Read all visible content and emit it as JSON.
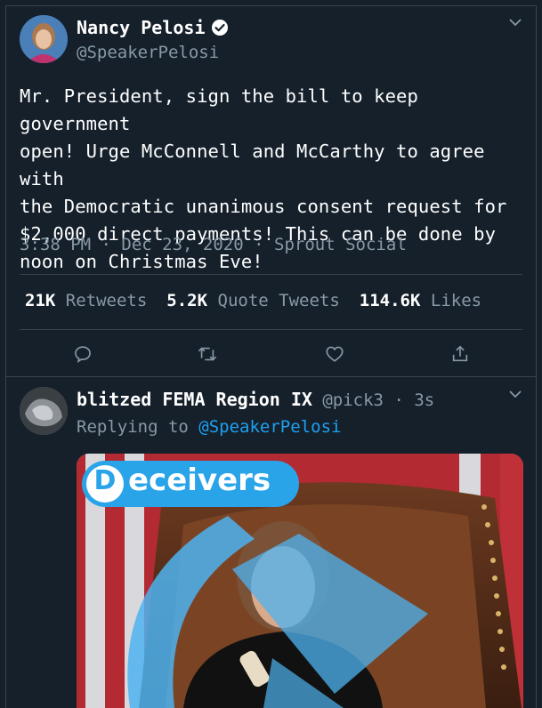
{
  "main_tweet": {
    "author_name": "Nancy Pelosi",
    "verified": true,
    "handle": "@SpeakerPelosi",
    "text": "Mr. President, sign the bill to keep government\nopen! Urge McConnell and McCarthy to agree with\nthe Democratic unanimous consent request for\n$2,000 direct payments! This can be done by\nnoon on Christmas Eve!",
    "time": "3:38 PM",
    "date": "Dec 23, 2020",
    "source": "Sprout Social",
    "retweets_count": "21K",
    "retweets_label": "Retweets",
    "quote_count": "5.2K",
    "quote_label": "Quote Tweets",
    "likes_count": "114.6K",
    "likes_label": "Likes",
    "actions": [
      "reply-icon",
      "retweet-icon",
      "like-icon",
      "share-icon"
    ]
  },
  "reply": {
    "author_name": "blitzed FEMA Region IX",
    "handle": "@pick3",
    "age": "3s",
    "replying_prefix": "Replying to",
    "replying_to": "@SpeakerPelosi",
    "image": {
      "logo_letter": "D",
      "logo_text": "eceivers"
    }
  },
  "colors": {
    "background": "#15202b",
    "divider": "#38444d",
    "muted": "#8899a6",
    "accent": "#1da1f2"
  }
}
